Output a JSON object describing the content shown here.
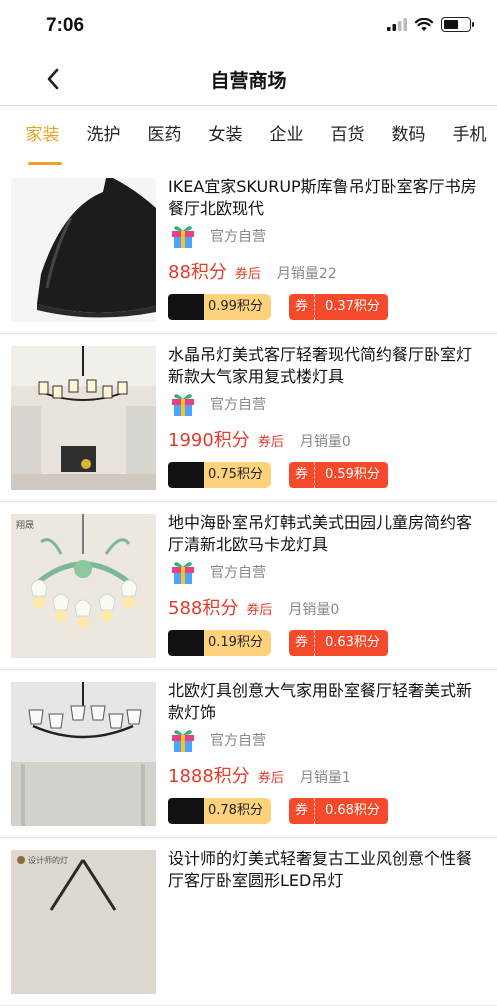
{
  "status": {
    "time": "7:06"
  },
  "nav": {
    "title": "自营商场"
  },
  "tabs": [
    "家装",
    "洗护",
    "医药",
    "女装",
    "企业",
    "百货",
    "数码",
    "手机"
  ],
  "products": [
    {
      "name": "IKEA宜家SKURUP斯库鲁吊灯卧室客厅书房餐厅北欧现代",
      "shop": "官方自营",
      "price": "88积分",
      "coupon_after": "券后",
      "sales": "月销量22",
      "badge1": "0.99积分",
      "badge2_label": "券",
      "badge2": "0.37积分",
      "img": "pendant-lamp"
    },
    {
      "name": "水晶吊灯美式客厅轻奢现代简约餐厅卧室灯新款大气家用复式楼灯具",
      "shop": "官方自营",
      "price": "1990积分",
      "coupon_after": "券后",
      "sales": "月销量0",
      "badge1": "0.75积分",
      "badge2_label": "券",
      "badge2": "0.59积分",
      "img": "chandelier-room"
    },
    {
      "name": "地中海卧室吊灯韩式美式田园儿童房简约客厅清新北欧马卡龙灯具",
      "shop": "官方自营",
      "price": "588积分",
      "coupon_after": "券后",
      "sales": "月销量0",
      "badge1": "0.19积分",
      "badge2_label": "券",
      "badge2": "0.63积分",
      "img": "green-chandelier",
      "img_caption": "翔晟"
    },
    {
      "name": "北欧灯具创意大气家用卧室餐厅轻奢美式新款灯饰",
      "shop": "官方自营",
      "price": "1888积分",
      "coupon_after": "券后",
      "sales": "月销量1",
      "badge1": "0.78积分",
      "badge2_label": "券",
      "badge2": "0.68积分",
      "img": "white-chandelier"
    },
    {
      "name": "设计师的灯美式轻奢复古工业风创意个性餐厅客厅卧室圆形LED吊灯",
      "shop": "官方自营",
      "price": "",
      "coupon_after": "",
      "sales": "",
      "badge1": "",
      "badge2_label": "",
      "badge2": "",
      "img": "industrial-lamp",
      "img_caption": "设计师的灯"
    }
  ],
  "colors": {
    "accent": "#e8a323",
    "price": "#e23c2c",
    "coupon_red": "#f44a2b",
    "badge_yellow": "#fed27c"
  }
}
